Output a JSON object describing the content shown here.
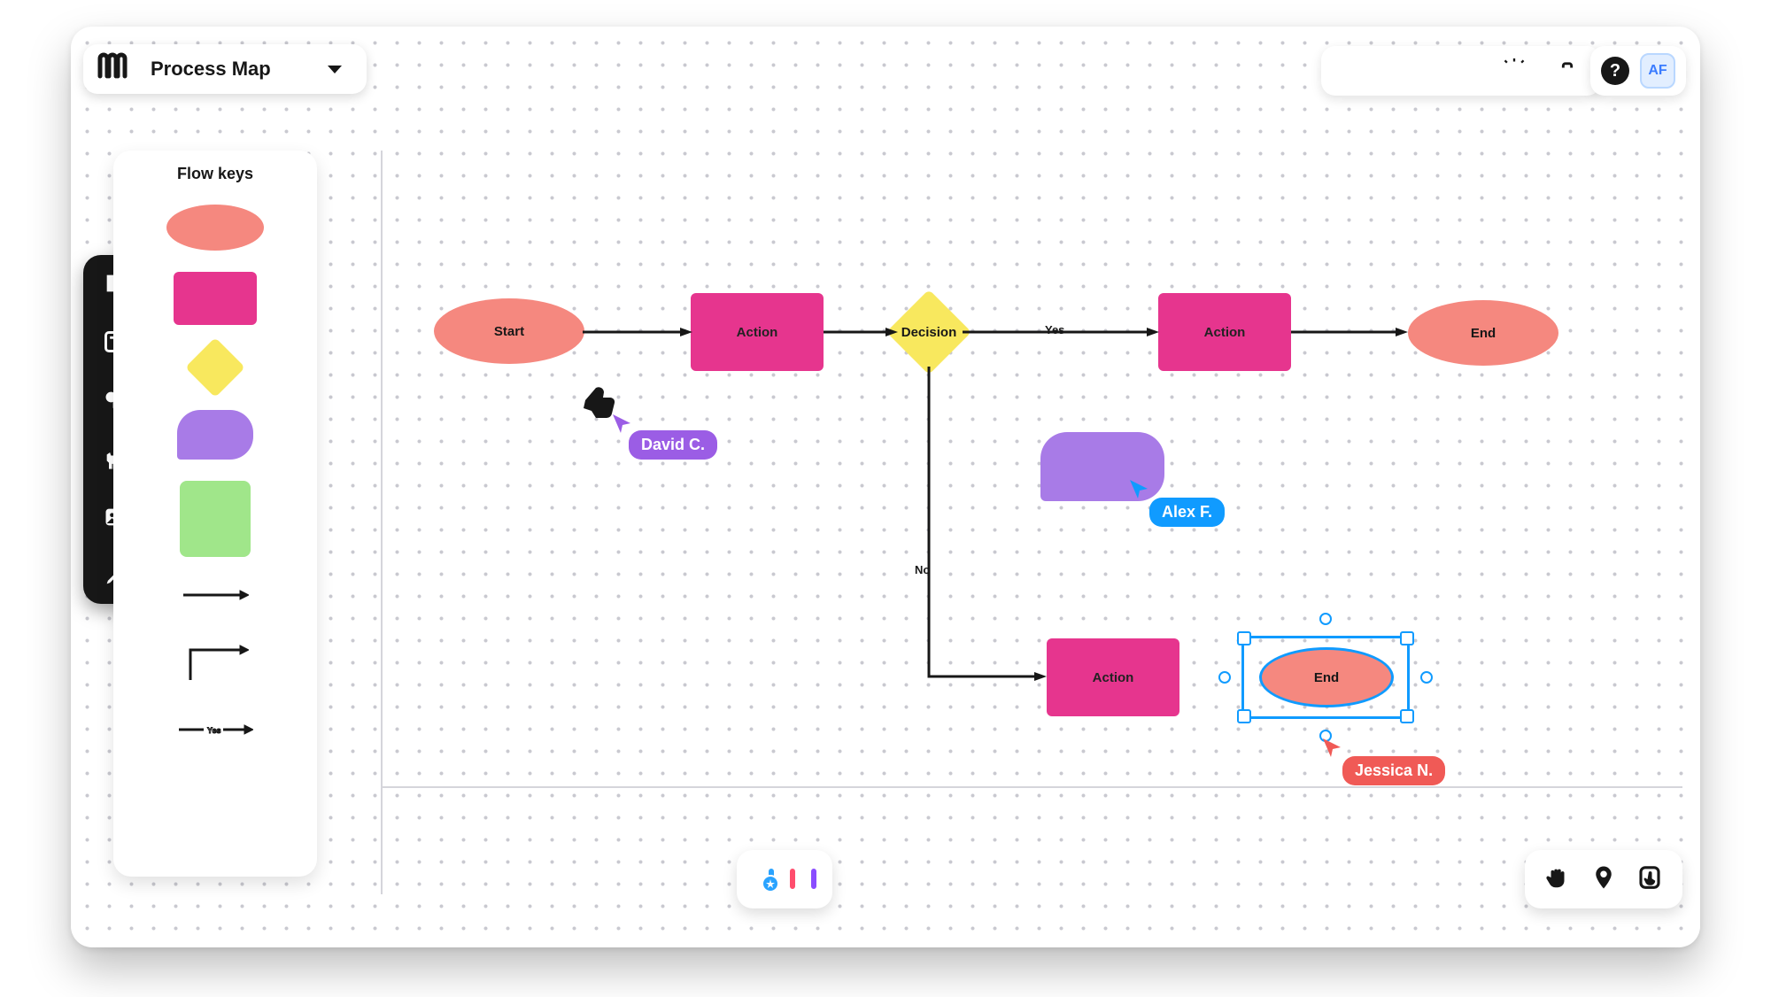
{
  "app": {
    "title": "Process Map"
  },
  "palette": {
    "title": "Flow keys"
  },
  "top_user": {
    "initials": "AF"
  },
  "nodes": {
    "start": {
      "label": "Start"
    },
    "action1": {
      "label": "Action"
    },
    "decision": {
      "label": "Decision"
    },
    "action2": {
      "label": "Action"
    },
    "end1": {
      "label": "End"
    },
    "action3": {
      "label": "Action"
    },
    "end2": {
      "label": "End"
    }
  },
  "edges": {
    "yes": "Yes",
    "no": "No"
  },
  "collaborators": {
    "david": {
      "name": "David C.",
      "color": "#9b5de5"
    },
    "alex": {
      "name": "Alex F.",
      "color": "#109bff"
    },
    "jessica": {
      "name": "Jessica N.",
      "color": "#f05a56"
    }
  }
}
